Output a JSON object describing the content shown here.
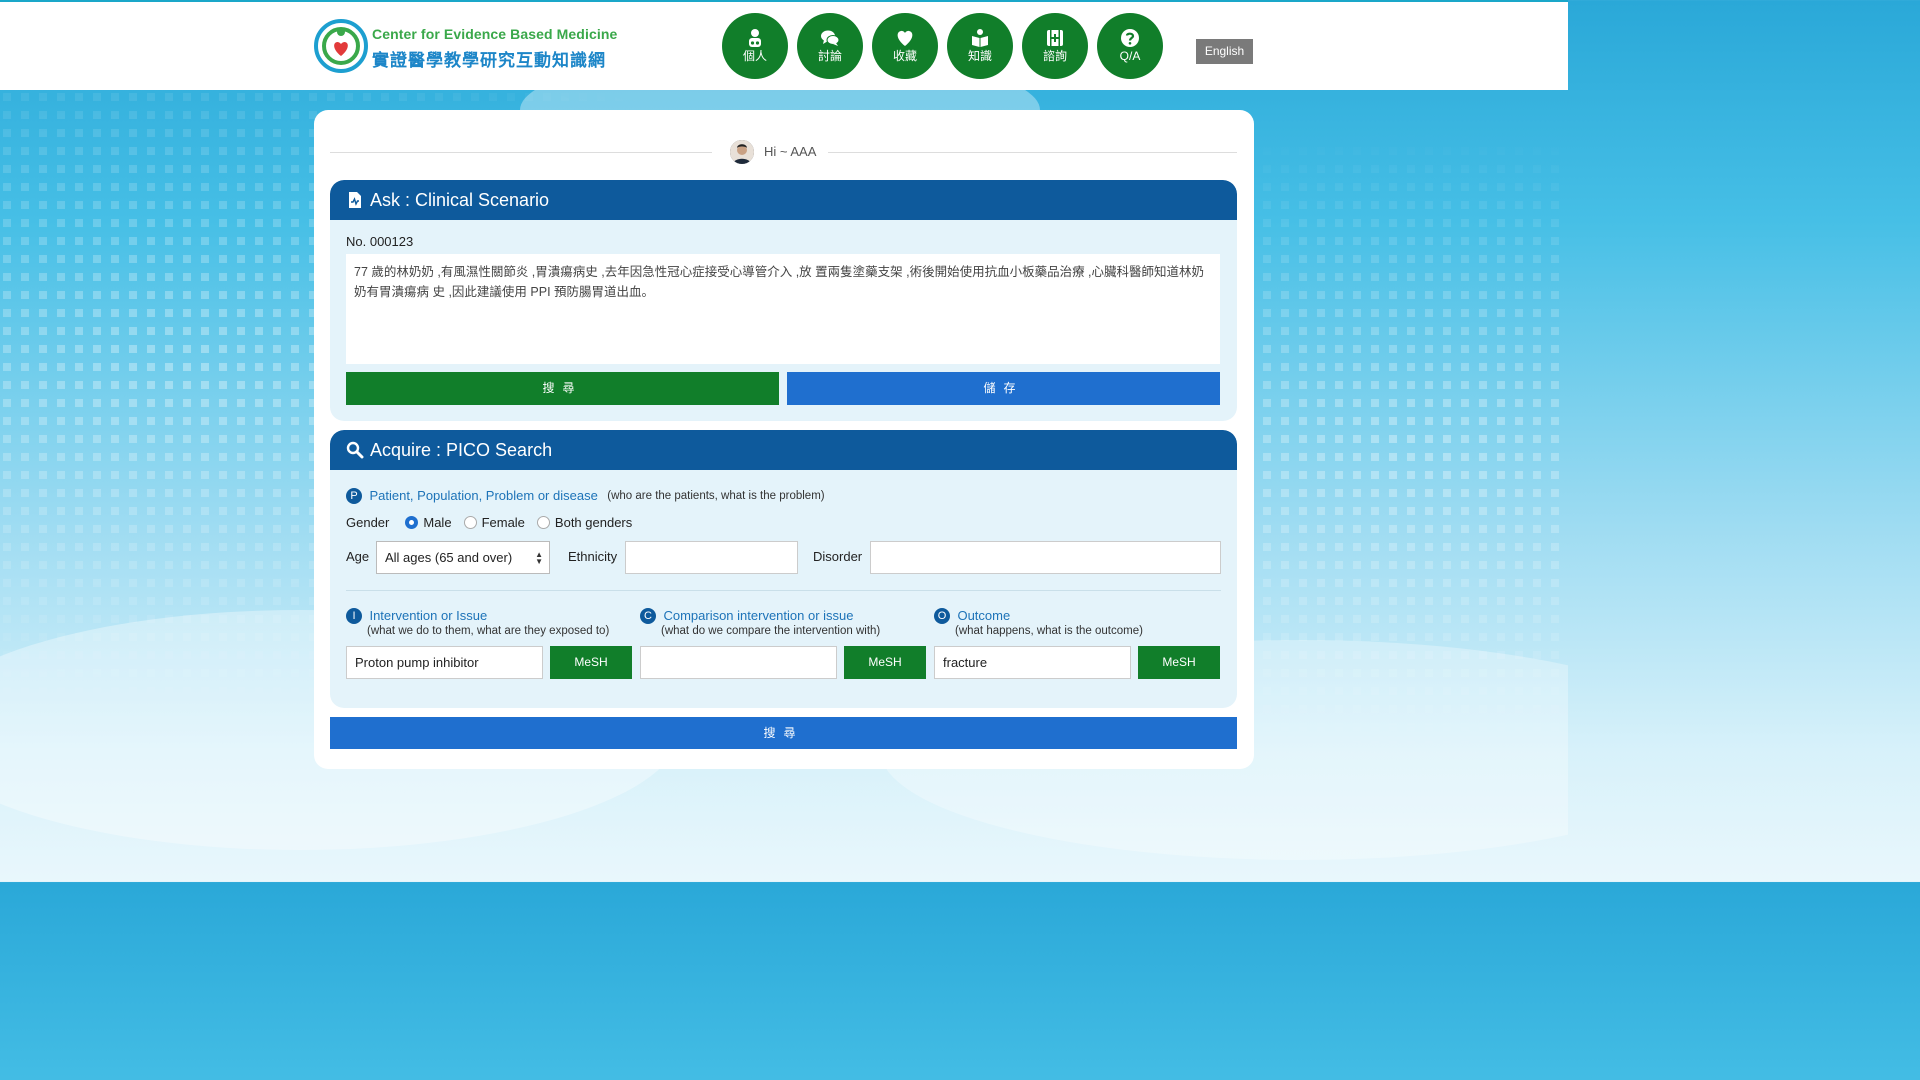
{
  "header": {
    "logo_en": "Center for Evidence Based Medicine",
    "logo_zh": "實證醫學教學研究互動知識網",
    "nav": [
      {
        "label": "個人",
        "icon": "person-icon"
      },
      {
        "label": "討論",
        "icon": "chat-icon"
      },
      {
        "label": "收藏",
        "icon": "heart-icon"
      },
      {
        "label": "知識",
        "icon": "book-icon"
      },
      {
        "label": "諮詢",
        "icon": "medical-kit-icon"
      },
      {
        "label": "Q/A",
        "icon": "question-icon"
      }
    ],
    "language_button": "English"
  },
  "greeting": {
    "text": "Hi ~ AAA"
  },
  "ask": {
    "title": "Ask : Clinical Scenario",
    "case_no": "No. 000123",
    "scenario": "77 歲的林奶奶 ,有風濕性關節炎 ,胃潰瘍病史 ,去年因急性冠心症接受心導管介入 ,放 置兩隻塗藥支架 ,術後開始使用抗血小板藥品治療 ,心臟科醫師知道林奶奶有胃潰瘍病 史 ,因此建議使用 PPI 預防腸胃道出血。",
    "search_button": "搜尋",
    "save_button": "儲存"
  },
  "acquire": {
    "title": "Acquire : PICO Search",
    "p": {
      "badge": "P",
      "title": "Patient, Population, Problem or disease",
      "hint": "(who are the patients, what is the problem)"
    },
    "gender": {
      "label": "Gender",
      "options": [
        "Male",
        "Female",
        "Both genders"
      ],
      "selected": "Male"
    },
    "age": {
      "label": "Age",
      "value": "All ages (65 and over)"
    },
    "ethnicity": {
      "label": "Ethnicity",
      "value": ""
    },
    "disorder": {
      "label": "Disorder",
      "value": ""
    },
    "i": {
      "badge": "I",
      "title": "Intervention or Issue",
      "sub": "(what we do to them, what are they exposed to)",
      "value": "Proton pump inhibitor"
    },
    "c": {
      "badge": "C",
      "title": "Comparison intervention or issue",
      "sub": "(what do we compare the intervention with)",
      "value": ""
    },
    "o": {
      "badge": "O",
      "title": "Outcome",
      "sub": "(what happens, what is the outcome)",
      "value": "fracture"
    },
    "mesh_button": "MeSH",
    "search_button": "搜尋"
  },
  "colors": {
    "header_blue": "#0e5a9c",
    "nav_green": "#117e2a",
    "button_blue": "#1f6fcf",
    "section_bg": "#e4f3fa"
  }
}
